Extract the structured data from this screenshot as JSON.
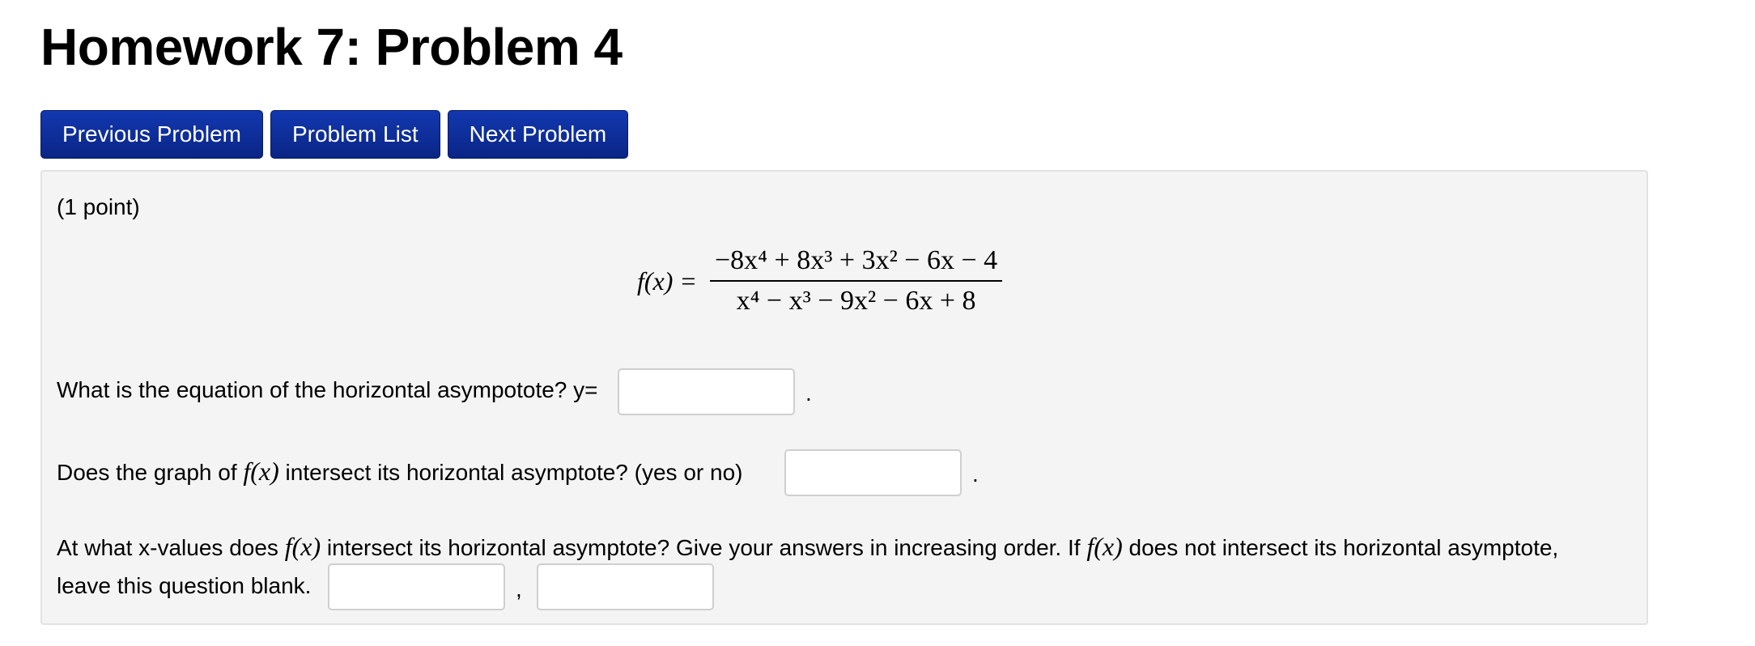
{
  "header": {
    "title": "Homework 7: Problem 4"
  },
  "nav": {
    "previous_label": "Previous Problem",
    "list_label": "Problem List",
    "next_label": "Next Problem"
  },
  "problem": {
    "points": "(1 point)",
    "formula": {
      "lhs": "f(x) =",
      "numerator": "−8x⁴ + 8x³ + 3x² − 6x − 4",
      "denominator": "x⁴ − x³ − 9x² − 6x + 8"
    },
    "q1": {
      "text": "What is the equation of the horizontal asympotote? y=",
      "value": "",
      "suffix": "."
    },
    "q2": {
      "text_before": "Does the graph of ",
      "fx": "f(x)",
      "text_after": " intersect its horizontal asymptote? (yes or no)",
      "value": "",
      "suffix": "."
    },
    "q3": {
      "text_1": "At what x-values does ",
      "fx_1": "f(x)",
      "text_2": " intersect its horizontal asymptote? Give your answers in increasing order. If ",
      "fx_2": "f(x)",
      "text_3": " does not intersect its horizontal asymptote,",
      "text_4": "leave this question blank.",
      "value_1": "",
      "value_2": "",
      "separator": ","
    }
  },
  "colors": {
    "button_bg": "#0b2a92",
    "panel_bg": "#f4f4f4"
  }
}
